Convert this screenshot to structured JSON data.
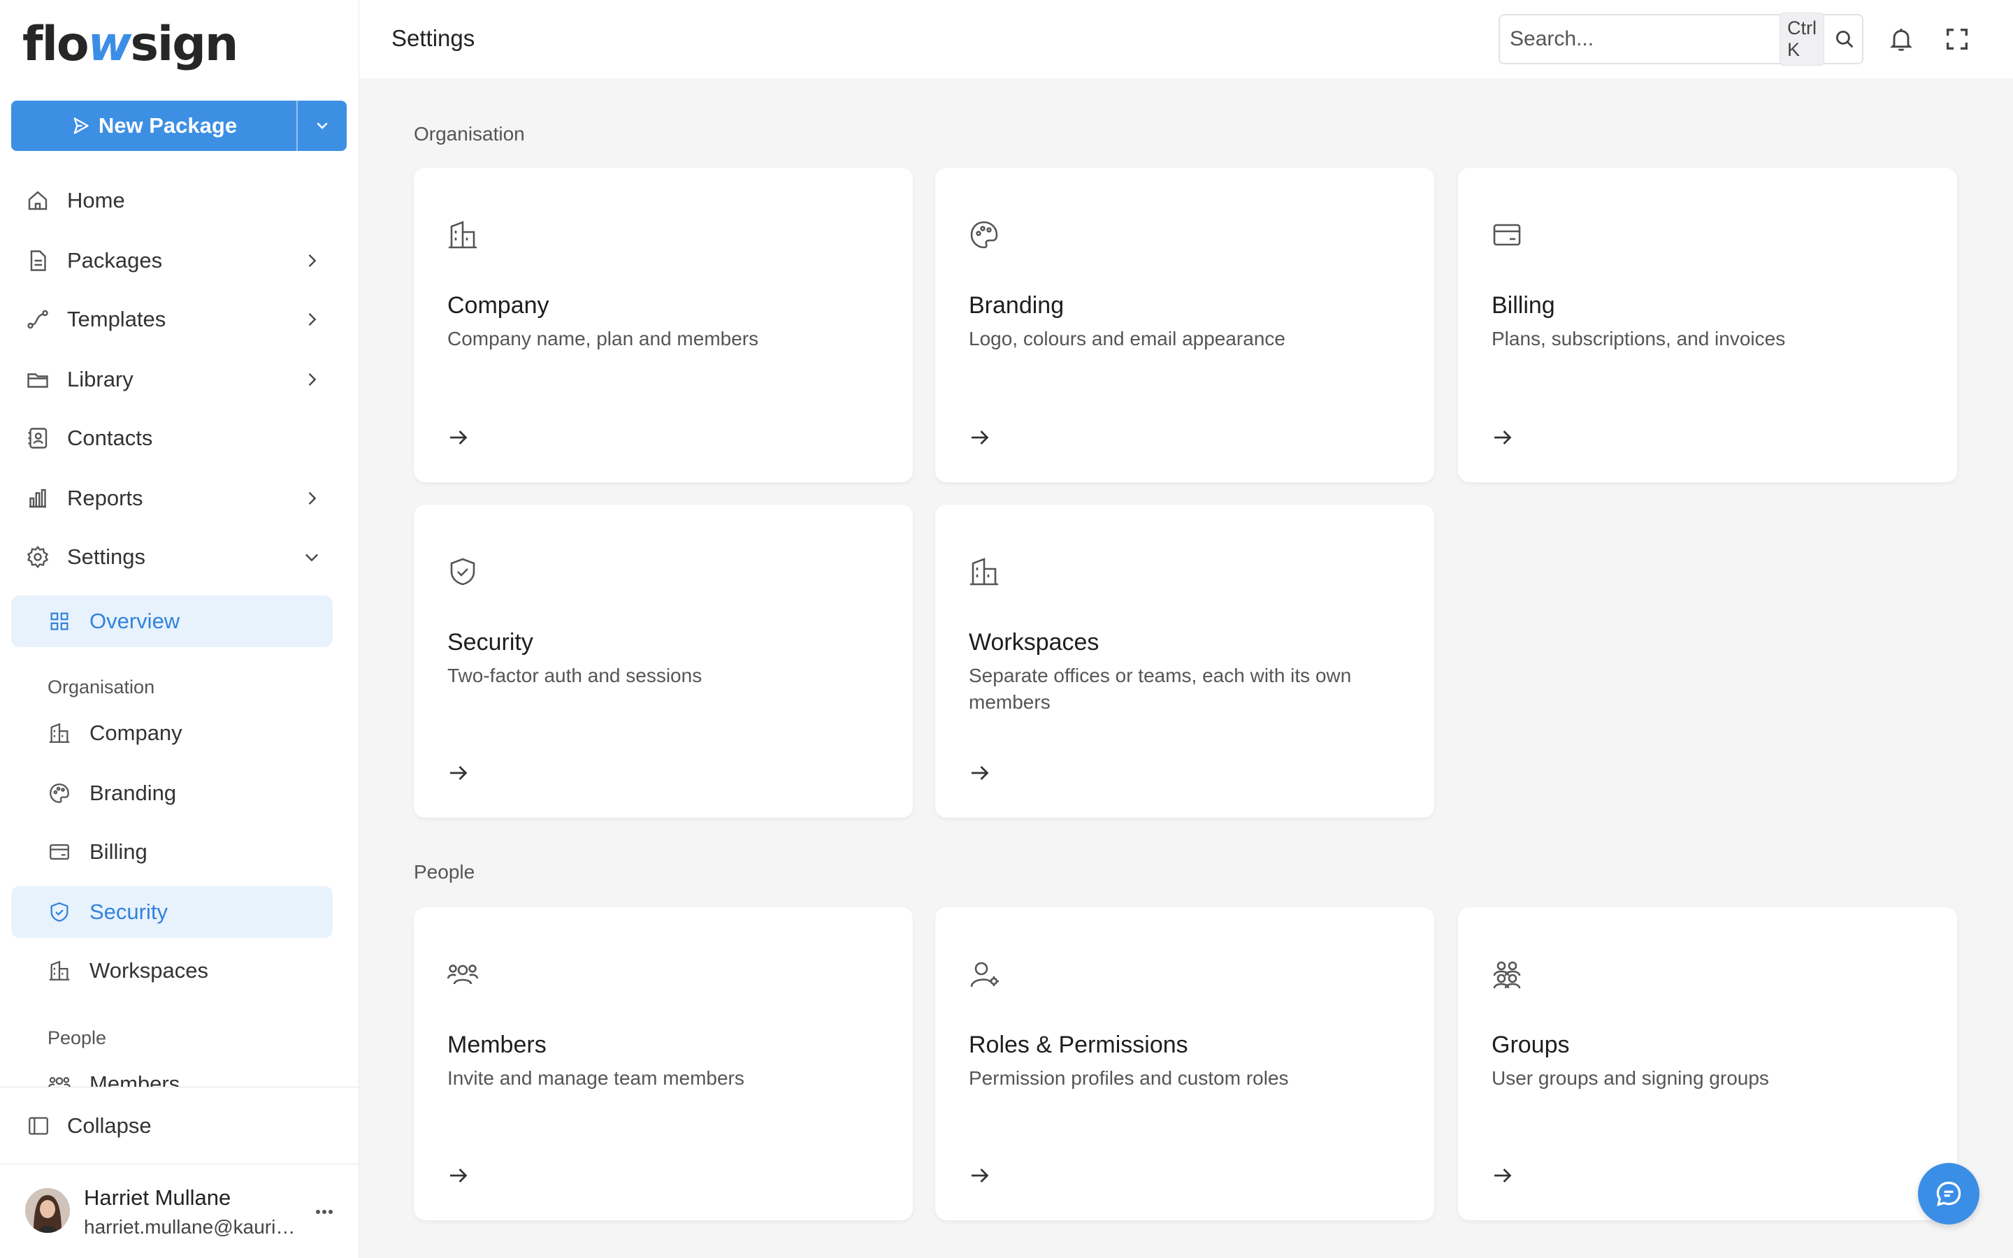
{
  "app": {
    "logo_prefix": "flo",
    "logo_accent": "w",
    "logo_suffix": "sign"
  },
  "colors": {
    "accent": "#3d8fe3",
    "active_bg": "#e8f2fd",
    "active_text": "#3282dc"
  },
  "new_package": {
    "label": "New Package"
  },
  "nav": {
    "home": "Home",
    "packages": "Packages",
    "templates": "Templates",
    "library": "Library",
    "contacts": "Contacts",
    "reports": "Reports",
    "settings": "Settings"
  },
  "settings_sub": {
    "overview": "Overview",
    "organisation_label": "Organisation",
    "company": "Company",
    "branding": "Branding",
    "billing": "Billing",
    "security": "Security",
    "workspaces": "Workspaces",
    "people_label": "People",
    "members": "Members"
  },
  "collapse": {
    "label": "Collapse"
  },
  "user": {
    "name": "Harriet Mullane",
    "email": "harriet.mullane@kauriri..."
  },
  "header": {
    "title": "Settings",
    "search_placeholder": "Search...",
    "search_shortcut": "Ctrl K"
  },
  "sections": {
    "organisation": {
      "title": "Organisation",
      "cards": [
        {
          "title": "Company",
          "desc": "Company name, plan and members",
          "icon": "building-icon"
        },
        {
          "title": "Branding",
          "desc": "Logo, colours and email appearance",
          "icon": "palette-icon"
        },
        {
          "title": "Billing",
          "desc": "Plans, subscriptions, and invoices",
          "icon": "credit-card-icon"
        },
        {
          "title": "Security",
          "desc": "Two-factor auth and sessions",
          "icon": "shield-check-icon"
        },
        {
          "title": "Workspaces",
          "desc": "Separate offices or teams, each with its own members",
          "icon": "building-icon"
        }
      ]
    },
    "people": {
      "title": "People",
      "cards": [
        {
          "title": "Members",
          "desc": "Invite and manage team members",
          "icon": "users-icon"
        },
        {
          "title": "Roles & Permissions",
          "desc": "Permission profiles and custom roles",
          "icon": "user-cog-icon"
        },
        {
          "title": "Groups",
          "desc": "User groups and signing groups",
          "icon": "users-group-icon"
        }
      ]
    }
  }
}
